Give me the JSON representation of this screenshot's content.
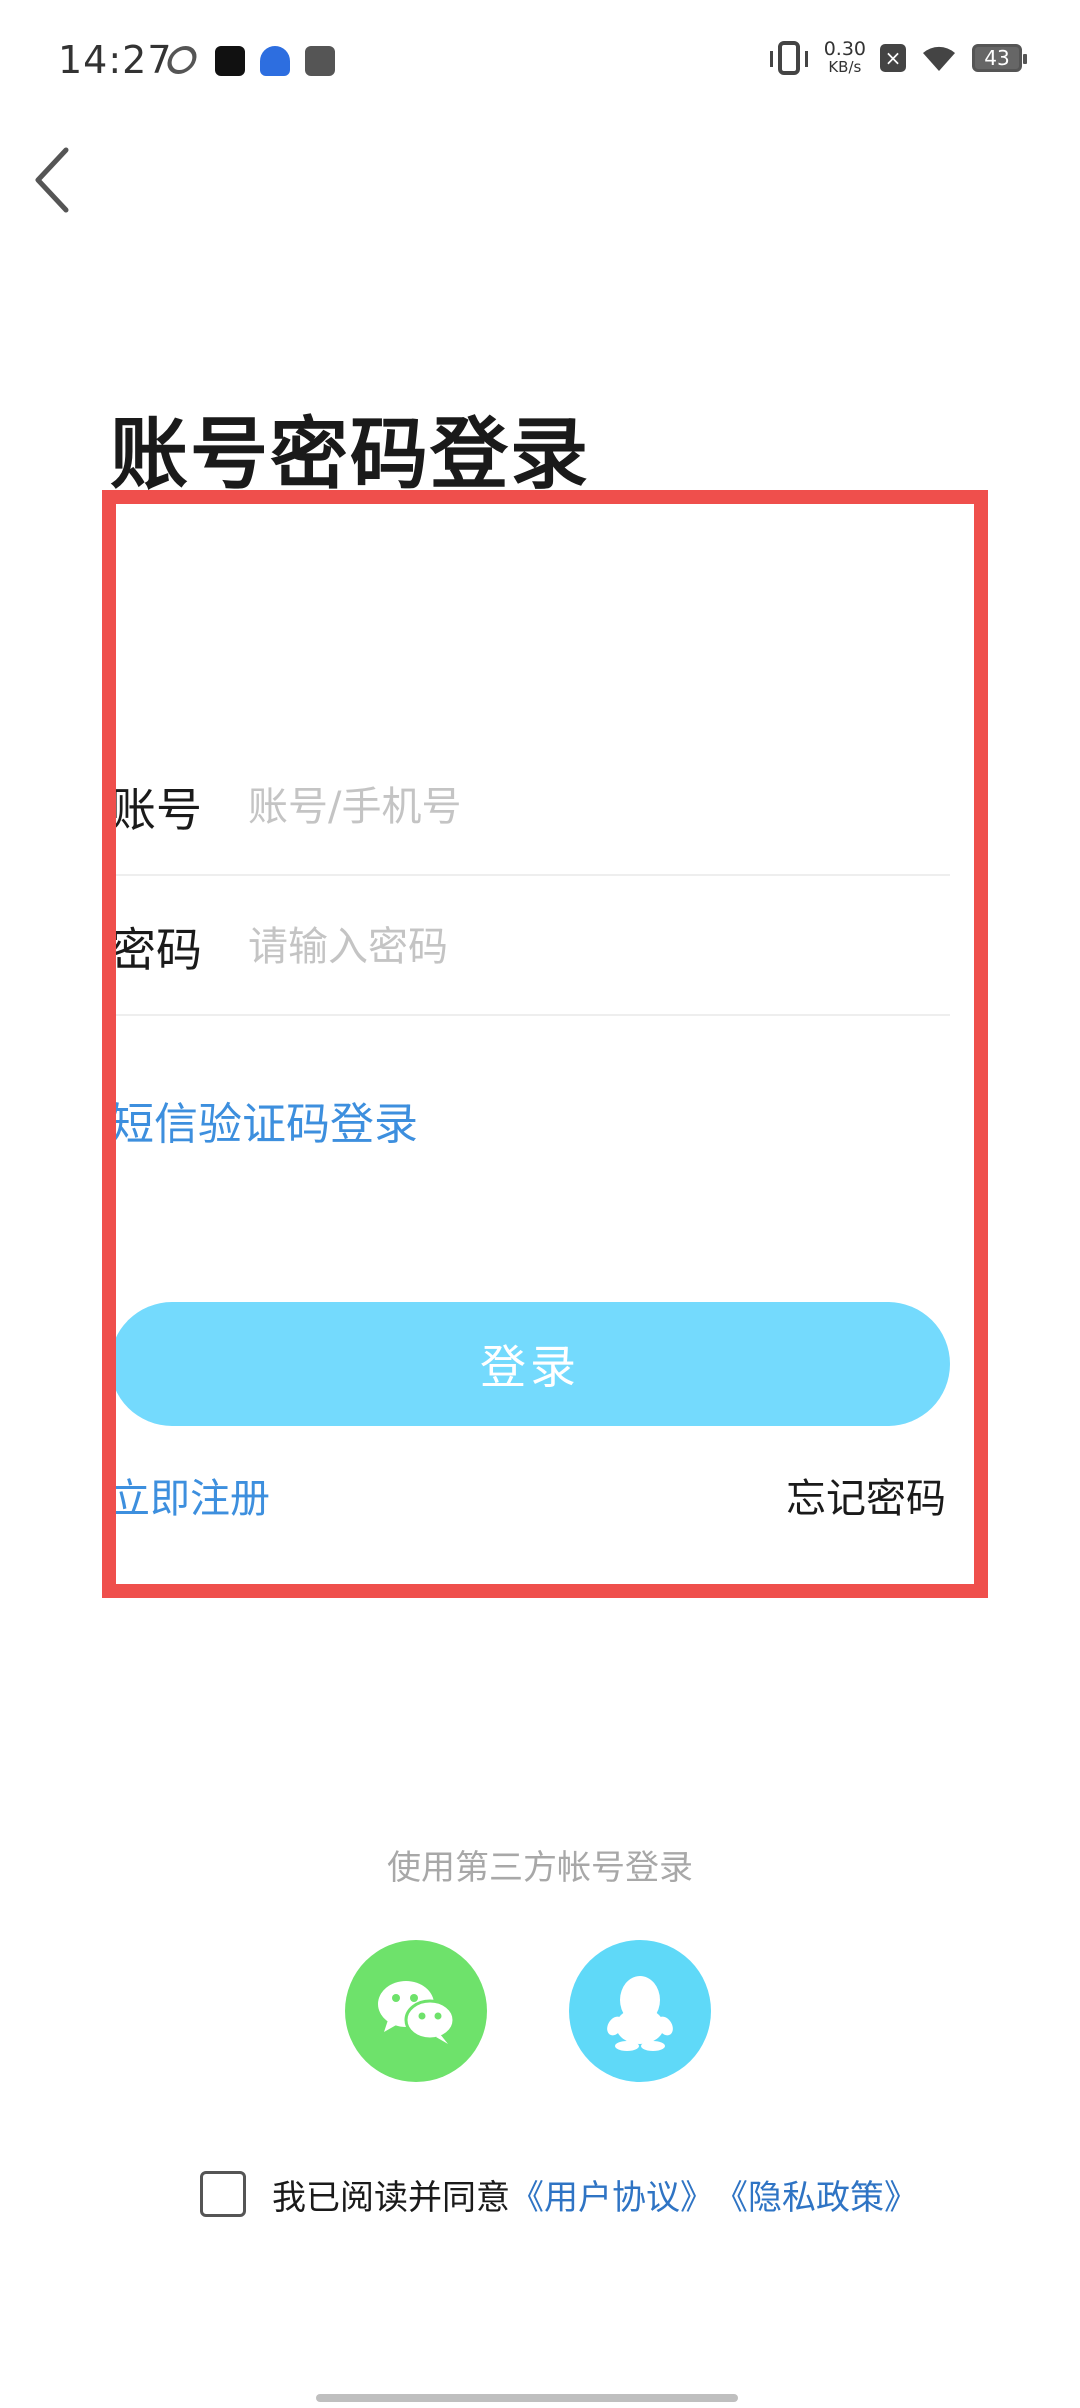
{
  "status_bar": {
    "time": "14:27",
    "net_speed_value": "0.30",
    "net_speed_unit": "KB/s",
    "battery": "43",
    "nosim_glyph": "×"
  },
  "title": "账号密码登录",
  "form": {
    "account_label": "账号",
    "account_placeholder": "账号/手机号",
    "password_label": "密码",
    "password_placeholder": "请输入密码",
    "sms_login": "短信验证码登录",
    "login_button": "登录",
    "register": "立即注册",
    "forgot_password": "忘记密码"
  },
  "third_party": {
    "title": "使用第三方帐号登录",
    "providers": [
      "wechat-icon",
      "qq-icon"
    ]
  },
  "agreement": {
    "text": "我已阅读并同意",
    "user_agreement": "《用户协议》",
    "privacy_policy": "《隐私政策》"
  },
  "colors": {
    "accent_blue": "#3d8fde",
    "login_button": "#74dafd",
    "wechat": "#6ee26b",
    "qq": "#5fd9f8",
    "highlight": "#ef4f4c"
  }
}
